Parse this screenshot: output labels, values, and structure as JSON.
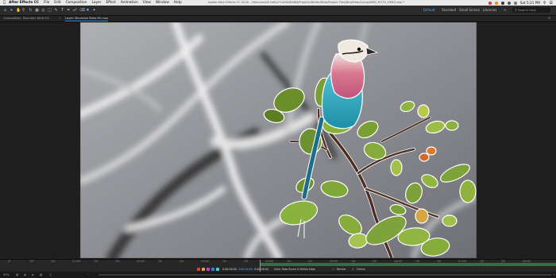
{
  "menubar": {
    "app_name": "After Effects CC",
    "menus": [
      "File",
      "Edit",
      "Composition",
      "Layer",
      "Effect",
      "Animation",
      "View",
      "Window",
      "Help"
    ],
    "window_title": "Adobe After Effects CC 2018 - /Volumes/AE-Daffy/*LIZAYARANN/Projects/Better/Roto/Project Files/Bird/Roto/Comp/BIRD_ROTO_HERO.aep *",
    "clock": "Sat 5:21 PM"
  },
  "toolbar": {
    "workspaces": [
      {
        "label": "Default",
        "active": true
      },
      {
        "label": "Standard",
        "active": false
      },
      {
        "label": "Small Screen",
        "active": false
      },
      {
        "label": "Libraries",
        "active": false
      }
    ],
    "search_placeholder": "Search Help"
  },
  "panel": {
    "tabs": [
      {
        "label": "Composition: Mountain Birds FG",
        "active": false
      },
      {
        "label": "Layer: Mountain Birds FG.mov",
        "active": true
      }
    ]
  },
  "timeline": {
    "ticks": [
      "0f",
      "10f",
      "20f",
      "01:00f",
      "10f",
      "20f",
      "02:00f",
      "10f",
      "20f",
      "03:00f",
      "10f",
      "20f",
      "04:00f",
      "10f",
      "20f",
      "05:00f",
      "10f",
      "20f",
      "06:00f",
      "10f",
      "20f",
      "07:00f",
      "10f",
      "20f",
      "08:00f"
    ],
    "current_time": "0:00:00:00",
    "start_time": "0:00:00:00",
    "duration": "0:00:08:00",
    "view_label": "View: Roto Brush & Refine Edge",
    "render_label": "Render",
    "freeze_label": "Freeze",
    "zoom": "50%",
    "progress": 0.0
  },
  "colors": {
    "accent": "#4fa3ff",
    "roto_track": "#3a6b47",
    "swatches": [
      "#e23b3b",
      "#e2a43b",
      "#d43bd4",
      "#3b7be2",
      "#3bd4c8"
    ]
  }
}
